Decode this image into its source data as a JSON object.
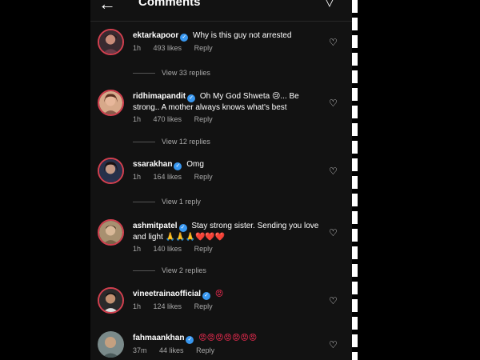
{
  "header": {
    "title": "Comments",
    "back_icon": "arrow-left-icon",
    "send_icon": "direct-send-icon"
  },
  "colors": {
    "background": "#121212",
    "verified": "#3897f0",
    "story_ring": "#d3404f",
    "secondary_text": "#a8a8a8"
  },
  "comments": [
    {
      "username": "ektarkapoor",
      "text": "Why is this guy not arrested",
      "time": "1h",
      "likes": "493 likes",
      "reply": "Reply",
      "view_replies": "View 33 replies"
    },
    {
      "username": "ridhimapandit",
      "text": "Oh My God Shweta 😢... Be strong.. A mother always knows what's best",
      "time": "1h",
      "likes": "470 likes",
      "reply": "Reply",
      "view_replies": "View 12 replies"
    },
    {
      "username": "ssarakhan",
      "text": "Omg",
      "time": "1h",
      "likes": "164 likes",
      "reply": "Reply",
      "view_replies": "View 1 reply"
    },
    {
      "username": "ashmitpatel",
      "text": "Stay strong sister. Sending you love and light 🙏🙏🙏❤️❤️❤️",
      "time": "1h",
      "likes": "140 likes",
      "reply": "Reply",
      "view_replies": "View 2 replies"
    },
    {
      "username": "vineetrainaofficial",
      "text": "😡",
      "time": "1h",
      "likes": "124 likes",
      "reply": "Reply"
    },
    {
      "username": "fahmaankhan",
      "text": "😡😡😡😡😡😡😡",
      "time": "37m",
      "likes": "44 likes",
      "reply": "Reply"
    }
  ]
}
